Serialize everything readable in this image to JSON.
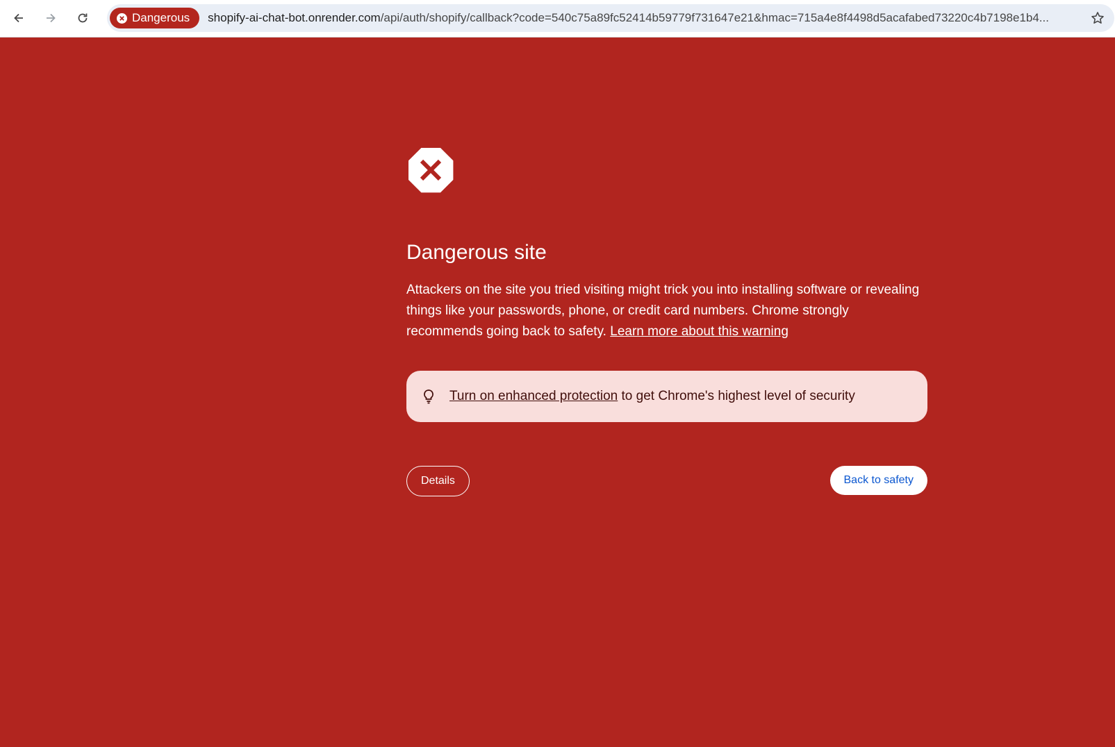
{
  "browser": {
    "security_chip": {
      "label": "Dangerous",
      "color": "#b3261e"
    },
    "url": {
      "host": "shopify-ai-chat-bot.onrender.com",
      "path": "/api/auth/shopify/callback?code=540c75a89fc52414b59779f731647e21&hmac=715a4e8f4498d5acafabed73220c4b7198e1b4..."
    },
    "icons": [
      "back-arrow-icon",
      "forward-arrow-icon",
      "reload-icon",
      "bookmark-star-icon"
    ]
  },
  "interstitial": {
    "background_color": "#b1251f",
    "icon": "error-octagon-icon",
    "heading": "Dangerous site",
    "body": "Attackers on the site you tried visiting might trick you into installing software or revealing things like your passwords, phone, or credit card numbers. Chrome strongly recommends going back to safety. ",
    "learn_more_link": "Learn more about this warning",
    "tip": {
      "icon": "lightbulb-icon",
      "link": "Turn on enhanced protection",
      "text": " to get Chrome's highest level of security"
    },
    "details_button": "Details",
    "back_button": "Back to safety"
  }
}
